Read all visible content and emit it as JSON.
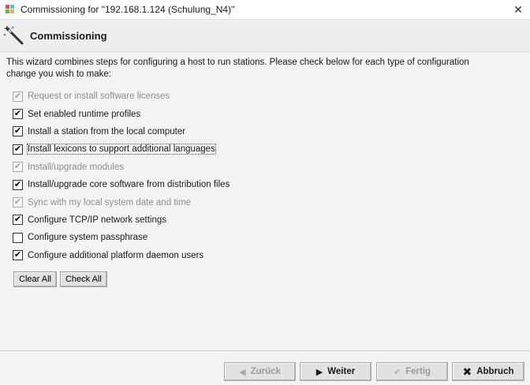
{
  "window": {
    "title": "Commissioning for \"192.168.1.124 (Schulung_N4)\"",
    "close_glyph": "✕"
  },
  "header": {
    "title": "Commissioning",
    "icon": "magic-wand-icon"
  },
  "intro": {
    "line1": "This wizard combines steps for configuring a host to run stations. Please check below for each type of configuration",
    "line2": "change you wish to make:"
  },
  "options": [
    {
      "label": "Request or install software licenses",
      "checked": true,
      "enabled": false
    },
    {
      "label": "Set enabled runtime profiles",
      "checked": true,
      "enabled": true
    },
    {
      "label": "Install a station from the local computer",
      "checked": true,
      "enabled": true
    },
    {
      "label": "Install lexicons to support additional languages",
      "checked": true,
      "enabled": true,
      "focused": true
    },
    {
      "label": "Install/upgrade modules",
      "checked": true,
      "enabled": false
    },
    {
      "label": "Install/upgrade core software from distribution files",
      "checked": true,
      "enabled": true
    },
    {
      "label": "Sync with my local system date and time",
      "checked": true,
      "enabled": false
    },
    {
      "label": "Configure TCP/IP network settings",
      "checked": true,
      "enabled": true
    },
    {
      "label": "Configure system passphrase",
      "checked": false,
      "enabled": true
    },
    {
      "label": "Configure additional platform daemon users",
      "checked": true,
      "enabled": true
    }
  ],
  "selection_buttons": {
    "clear_all": "Clear All",
    "check_all": "Check All"
  },
  "nav": {
    "back": {
      "label": "Zurück",
      "enabled": false,
      "icon": "back-arrow-icon"
    },
    "next": {
      "label": "Weiter",
      "enabled": true,
      "icon": "forward-arrow-icon"
    },
    "finish": {
      "label": "Fertig",
      "enabled": false,
      "icon": "checkmark-icon"
    },
    "cancel": {
      "label": "Abbruch",
      "enabled": true,
      "icon": "cancel-x-icon"
    }
  }
}
